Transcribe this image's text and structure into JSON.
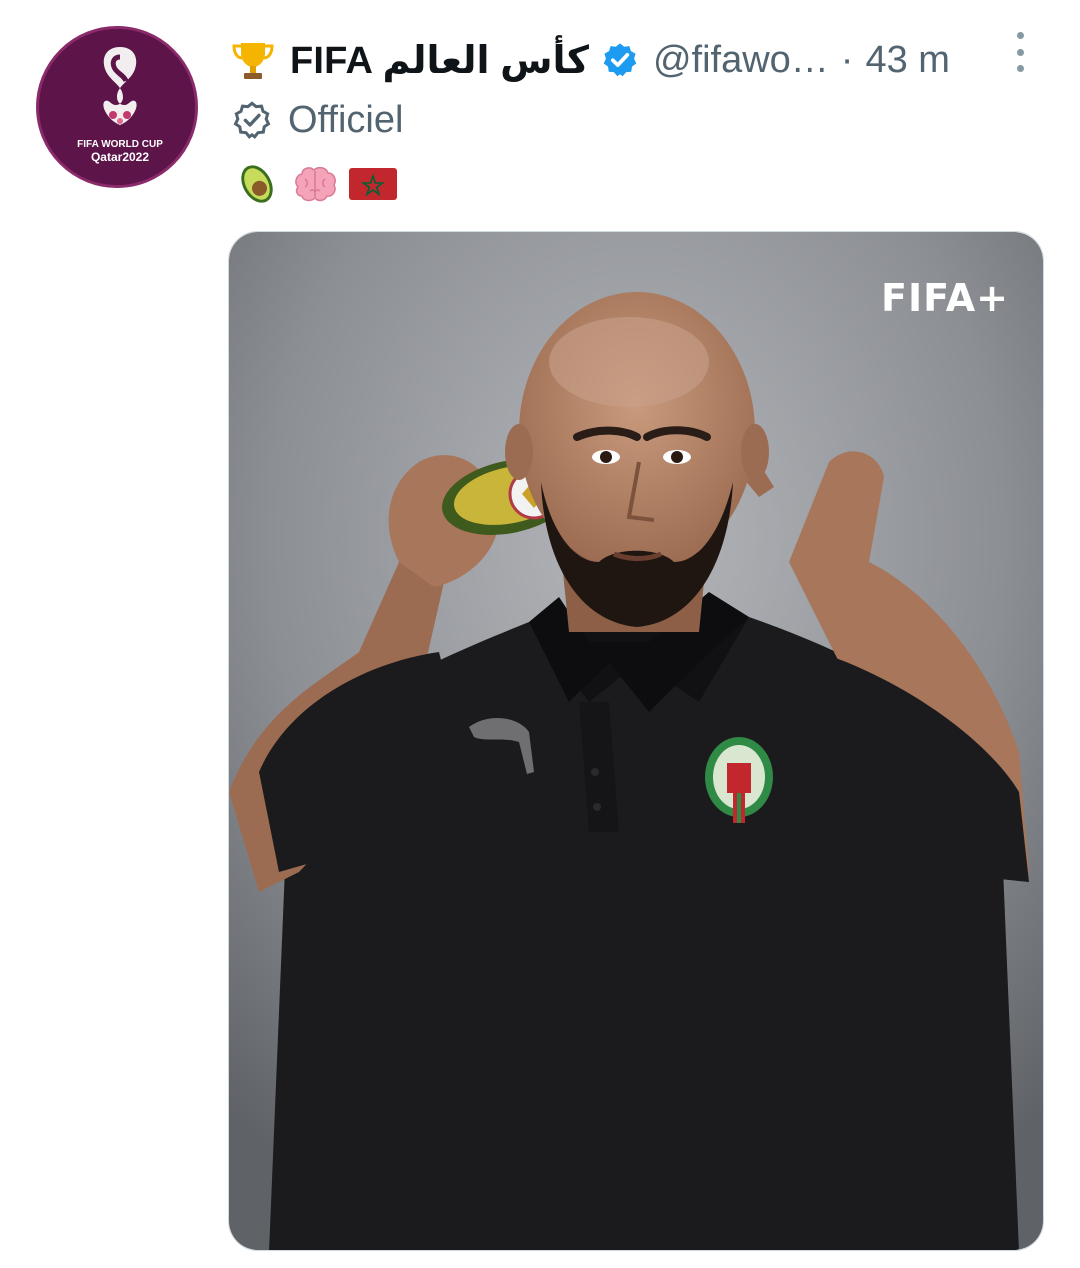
{
  "tweet": {
    "author_name": "FIFA كأس العالم",
    "handle": "@fifawo…",
    "separator": "·",
    "time": "43 m",
    "label": "Officiel",
    "emojis": [
      "avocado",
      "brain",
      "morocco-flag"
    ],
    "avatar_text": {
      "line1": "FIFA WORLD CUP",
      "line2": "Qatar2022"
    },
    "image_watermark": "FIFA+"
  },
  "colors": {
    "verified": "#1d9bf0",
    "secondary_text": "#536471",
    "avatar_bg": "#5c1449",
    "photo_bg": "#8a8d92"
  },
  "icons": {
    "prefix": "trophy-icon",
    "verified": "verified-badge-icon",
    "label": "official-check-icon",
    "more": "more-options-icon"
  }
}
